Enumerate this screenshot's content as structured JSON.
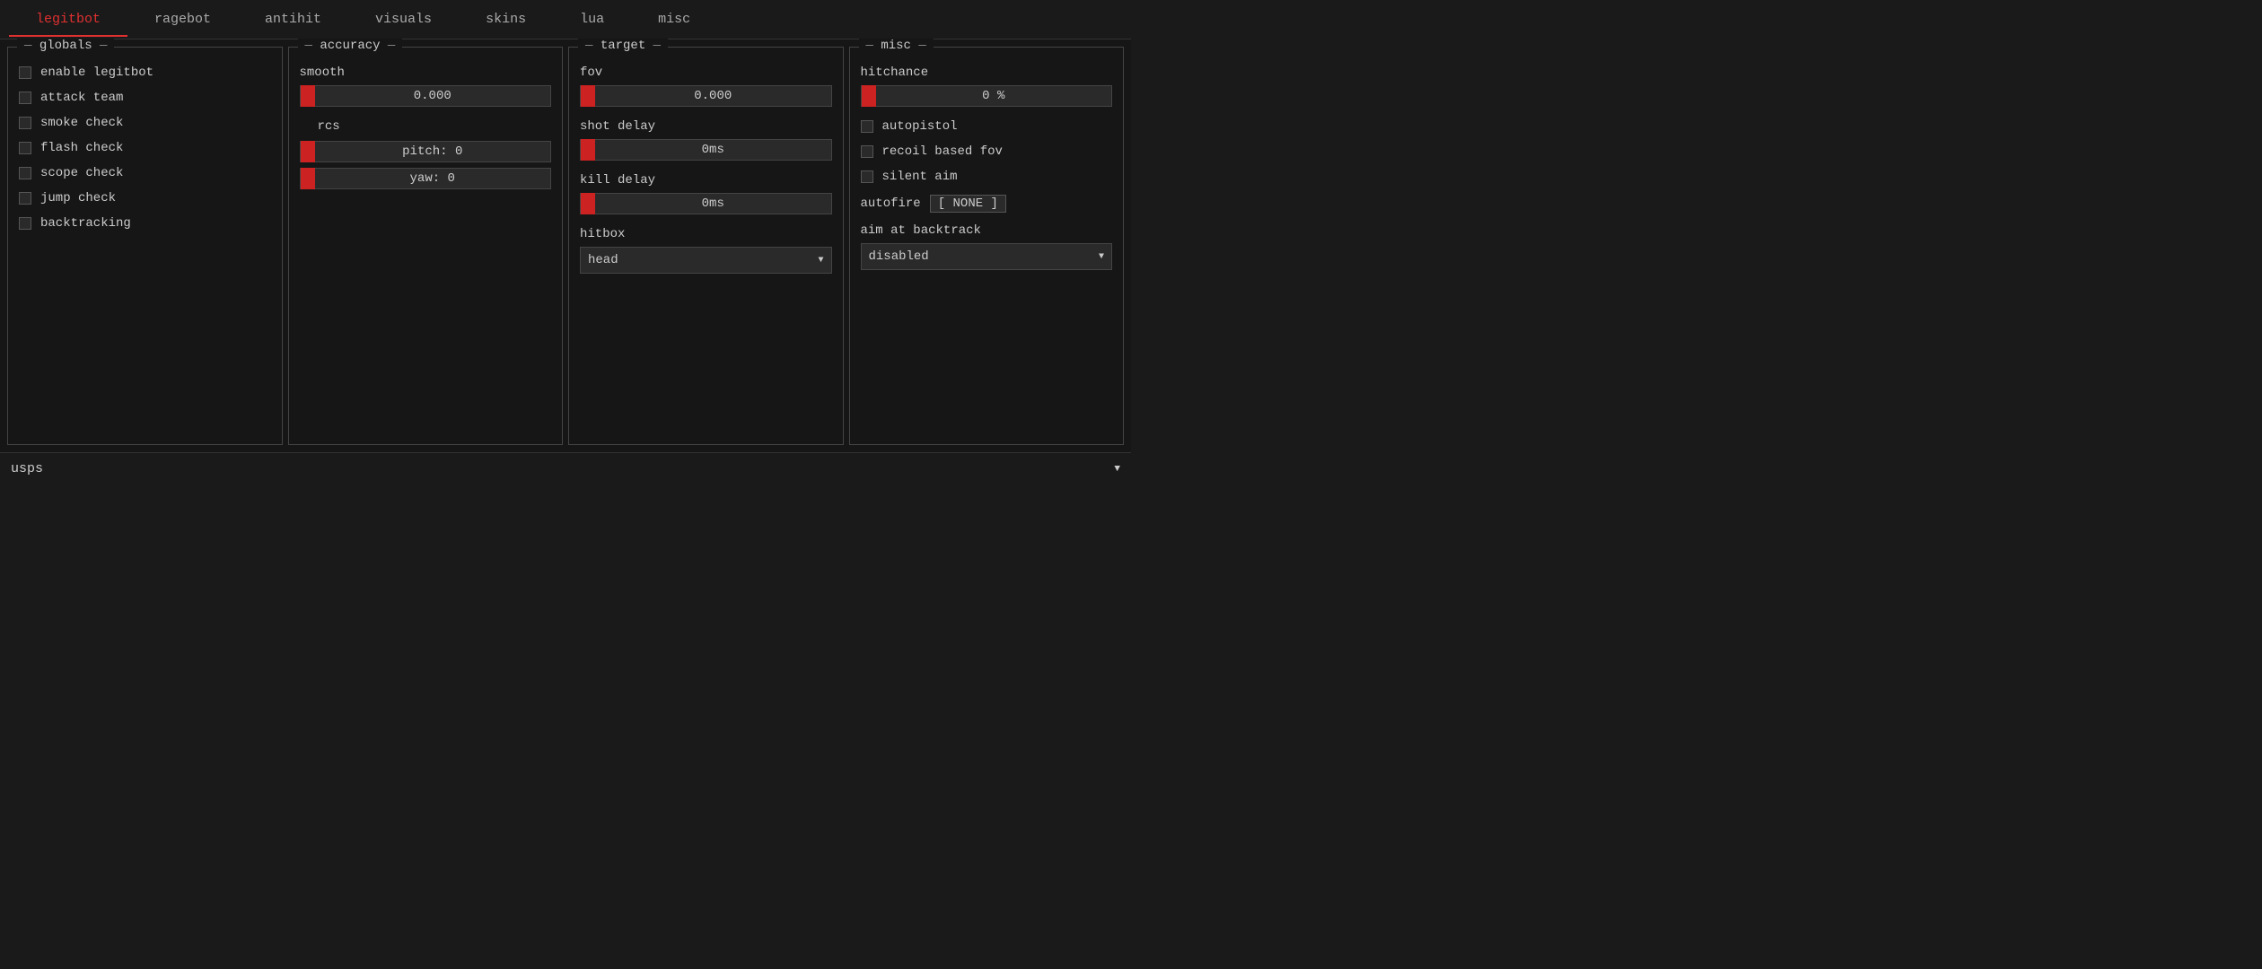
{
  "tabs": [
    {
      "id": "legitbot",
      "label": "legitbot",
      "active": true
    },
    {
      "id": "ragebot",
      "label": "ragebot",
      "active": false
    },
    {
      "id": "antihit",
      "label": "antihit",
      "active": false
    },
    {
      "id": "visuals",
      "label": "visuals",
      "active": false
    },
    {
      "id": "skins",
      "label": "skins",
      "active": false
    },
    {
      "id": "lua",
      "label": "lua",
      "active": false
    },
    {
      "id": "misc",
      "label": "misc",
      "active": false
    }
  ],
  "panels": {
    "globals": {
      "title": "globals",
      "items": [
        {
          "label": "enable legitbot",
          "checked": false
        },
        {
          "label": "attack team",
          "checked": false
        },
        {
          "label": "smoke check",
          "checked": false
        },
        {
          "label": "flash check",
          "checked": false
        },
        {
          "label": "scope check",
          "checked": false
        },
        {
          "label": "jump check",
          "checked": false
        },
        {
          "label": "backtracking",
          "checked": false
        }
      ]
    },
    "accuracy": {
      "title": "accuracy",
      "smooth_label": "smooth",
      "smooth_value": "0.000",
      "rcs_label": "rcs",
      "pitch_label": "pitch: 0",
      "yaw_label": "yaw: 0"
    },
    "target": {
      "title": "target",
      "fov_label": "fov",
      "fov_value": "0.000",
      "shot_delay_label": "shot delay",
      "shot_delay_value": "0ms",
      "kill_delay_label": "kill delay",
      "kill_delay_value": "0ms",
      "hitbox_label": "hitbox",
      "hitbox_value": "head"
    },
    "misc": {
      "title": "misc",
      "hitchance_label": "hitchance",
      "hitchance_value": "0 %",
      "autopistol_label": "autopistol",
      "recoil_based_fov_label": "recoil based fov",
      "silent_aim_label": "silent aim",
      "autofire_label": "autofire",
      "autofire_bind": "[ NONE ]",
      "aim_at_backtrack_label": "aim at backtrack",
      "aim_at_backtrack_value": "disabled"
    }
  },
  "bottom_bar": {
    "weapon": "usps",
    "arrow": "▼"
  }
}
